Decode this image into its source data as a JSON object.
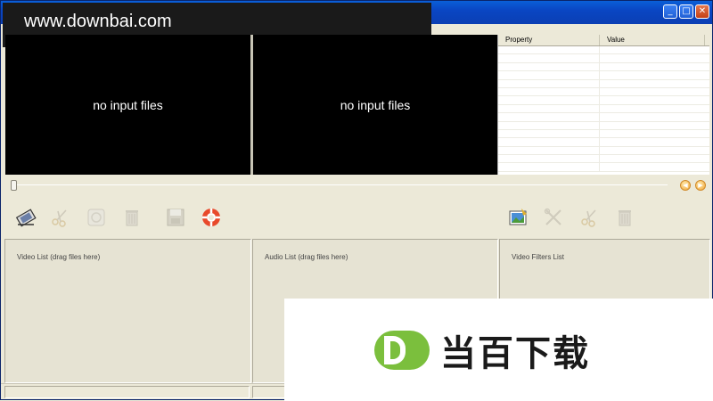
{
  "watermark": {
    "url": "www.downbai.com"
  },
  "titlebar": {
    "minimize": "_",
    "maximize": "□",
    "close": "✕"
  },
  "preview": {
    "left_text": "no input files",
    "right_text": "no input files"
  },
  "properties": {
    "col_property": "Property",
    "col_value": "Value"
  },
  "lists": {
    "video": "Video List (drag files here)",
    "audio": "Audio List (drag files here)",
    "filters": "Video Filters List"
  },
  "brand": {
    "text": "当百下载",
    "logo_color": "#7bbf3d"
  },
  "icons": {
    "left_toolbar": [
      "open-video-icon",
      "cut-icon",
      "info-icon",
      "delete-icon",
      "save-icon",
      "help-icon"
    ],
    "right_toolbar": [
      "add-filter-icon",
      "tools-icon",
      "cut-icon",
      "delete-icon"
    ]
  }
}
